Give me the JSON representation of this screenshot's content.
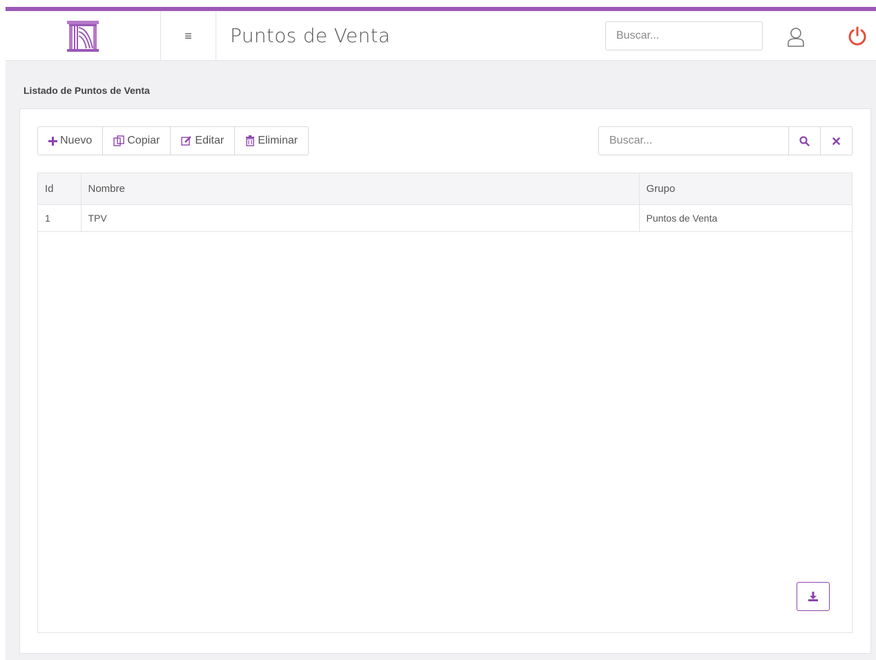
{
  "header": {
    "title": "Puntos de Venta",
    "search_placeholder": "Buscar...",
    "menu_glyph": "≡",
    "logo_icon": "gate-logo-icon",
    "user_icon": "user-icon",
    "power_icon": "power-icon"
  },
  "section": {
    "label": "Listado de Puntos de Venta"
  },
  "toolbar": {
    "new_label": "Nuevo",
    "copy_label": "Copiar",
    "edit_label": "Editar",
    "delete_label": "Eliminar",
    "search_placeholder": "Buscar..."
  },
  "table": {
    "columns": [
      "Id",
      "Nombre",
      "Grupo"
    ],
    "rows": [
      [
        "1",
        "TPV",
        "Puntos de Venta"
      ]
    ]
  },
  "colors": {
    "accent": "#9b59b6",
    "accent_dark": "#8e44ad",
    "power": "#e74c3c",
    "background": "#f1f1f4"
  }
}
